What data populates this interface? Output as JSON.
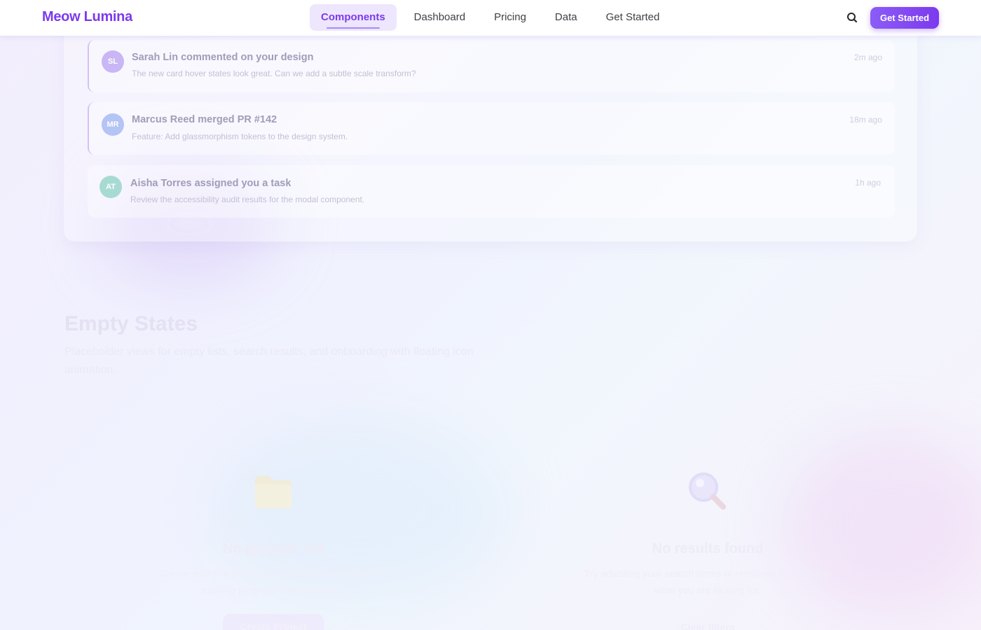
{
  "nav": {
    "brand": "Meow Lumina",
    "links": [
      {
        "label": "Components",
        "active": true
      },
      {
        "label": "Dashboard",
        "active": false
      },
      {
        "label": "Pricing",
        "active": false
      },
      {
        "label": "Data",
        "active": false
      },
      {
        "label": "Get Started",
        "active": false
      }
    ],
    "search_icon": "search-icon",
    "cta_label": "Get Started"
  },
  "activity": {
    "items": [
      {
        "initials": "SL",
        "title": "Sarah Lin commented on your design",
        "description": "The new card hover states look great. Can we add a subtle scale transform?",
        "time": "2m ago",
        "avatar_color": "#c9b6f5"
      },
      {
        "initials": "MR",
        "title": "Marcus Reed merged PR #142",
        "description": "Feature: Add glassmorphism tokens to the design system.",
        "time": "18m ago",
        "avatar_color": "#b3c4f5"
      },
      {
        "initials": "AT",
        "title": "Aisha Torres assigned you a task",
        "description": "Review the accessibility audit results for the modal component.",
        "time": "1h ago",
        "avatar_color": "#a8dad4"
      }
    ]
  },
  "empty_states": {
    "title": "Empty States",
    "subtitle": "Placeholder views for empty lists, search results, and onboarding with floating icon animation.",
    "cards": [
      {
        "icon": "folder-icon",
        "title": "No projects yet",
        "description": "Create your first project to start organizing tasks and tracking progress with your team.",
        "action_label": "Create Project"
      },
      {
        "icon": "magnifier-icon",
        "title": "No results found",
        "description": "Try adjusting your search terms or removing filters to find what you are looking for.",
        "action_label": "Clear filters"
      }
    ]
  },
  "colors": {
    "brand": "#7c3aed",
    "active_tab_bg": "#ede6fd",
    "accent_border": "#d2c2f7"
  }
}
